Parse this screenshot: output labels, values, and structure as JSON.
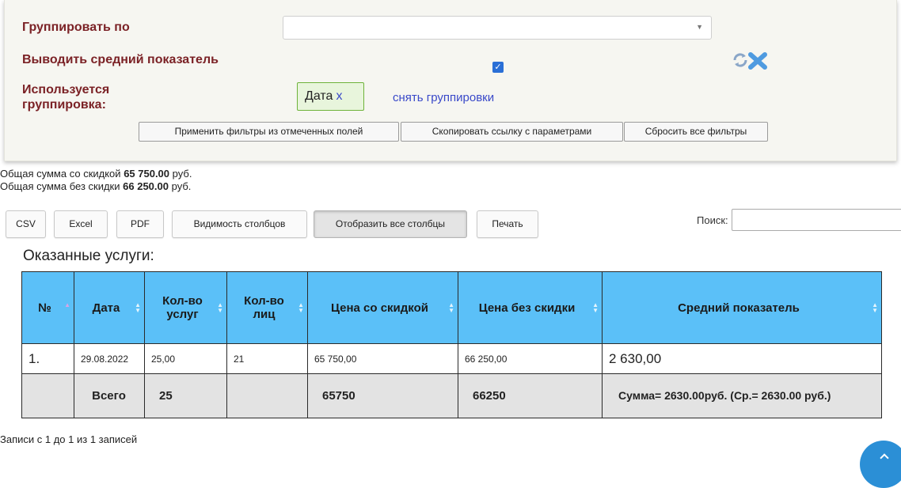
{
  "filters": {
    "group_by_label": "Группировать по",
    "group_by_value": "",
    "show_average_label": "Выводить средний показатель",
    "show_average_checked": true,
    "used_grouping_label": "Используется группировка:",
    "group_chip_label": "Дата",
    "group_chip_remove": "x",
    "remove_grouping_link": "снять группировки",
    "apply_button": "Применить фильтры из отмеченных полей",
    "copy_link_button": "Скопировать ссылку с параметрами",
    "reset_button": "Сбросить все фильтры"
  },
  "totals": {
    "with_discount_label": "Общая сумма со скидкой",
    "with_discount_value": "65 750.00",
    "without_discount_label": "Общая сумма без скидки",
    "without_discount_value": "66 250.00",
    "currency": "руб."
  },
  "toolbar": {
    "csv": "CSV",
    "excel": "Excel",
    "pdf": "PDF",
    "columns_visibility": "Видимость столбцов",
    "show_all_columns": "Отобразить все столбцы",
    "print": "Печать",
    "search_label": "Поиск:",
    "search_value": ""
  },
  "table": {
    "title": "Оказанные услуги:",
    "columns": [
      "№",
      "Дата",
      "Кол-во услуг",
      "Кол-во лиц",
      "Цена со скидкой",
      "Цена без скидки",
      "Средний показатель"
    ],
    "rows": [
      [
        "1.",
        "29.08.2022",
        "25,00",
        "21",
        "65 750,00",
        "66 250,00",
        "2 630,00"
      ]
    ],
    "summary": [
      "",
      "Всего",
      "25",
      "",
      "65750",
      "66250",
      "Сумма= 2630.00руб. (Ср.= 2630.00 руб.)"
    ]
  },
  "pager": {
    "info": "Записи с 1 до 1 из 1 записей"
  },
  "colors": {
    "header_bg": "#5bc0f8",
    "label_color": "#7b2226",
    "link_color": "#3a49c9",
    "summary_bg": "#e3e3e3"
  }
}
